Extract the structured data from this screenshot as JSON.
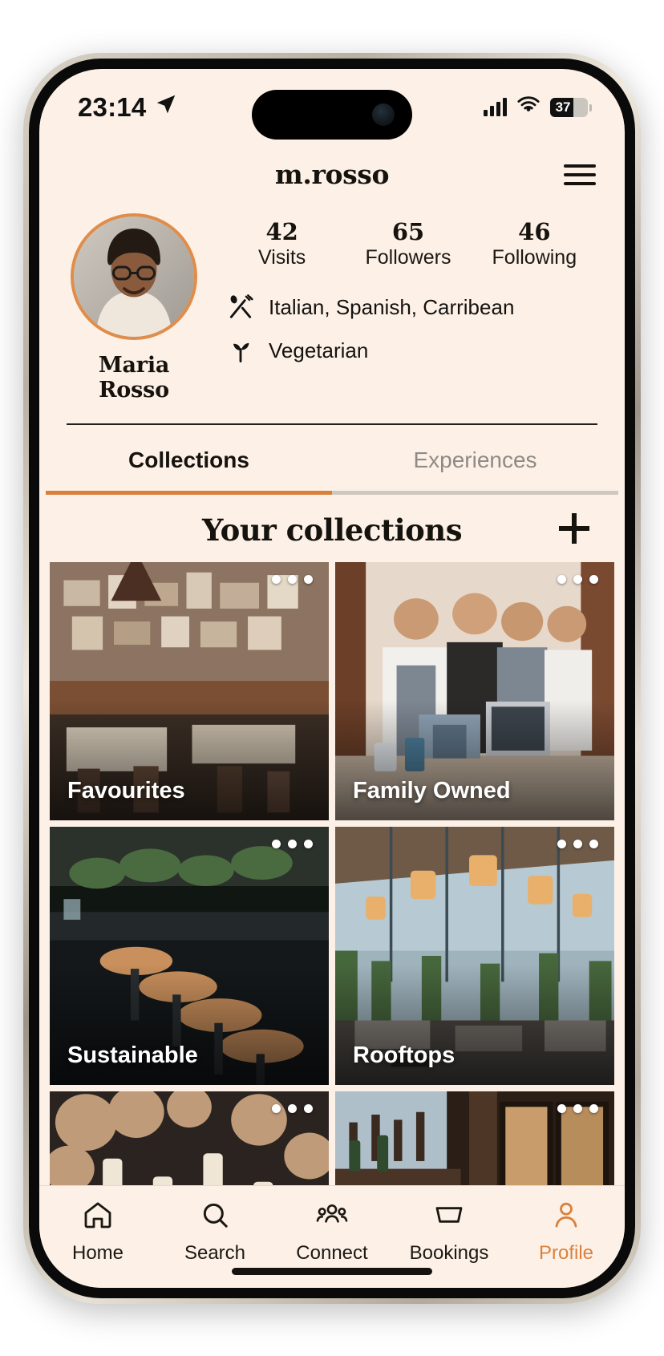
{
  "status_bar": {
    "time": "23:14",
    "location_icon": "location-arrow-icon",
    "signal_icon": "cellular-bars-icon",
    "wifi_icon": "wifi-icon",
    "battery_percent": "37"
  },
  "header": {
    "brand": "m.rosso",
    "menu_icon": "hamburger-menu-icon"
  },
  "profile": {
    "name": "Maria Rosso",
    "avatar_icon": "user-avatar-photo",
    "stats": [
      {
        "value": "42",
        "label": "Visits"
      },
      {
        "value": "65",
        "label": "Followers"
      },
      {
        "value": "46",
        "label": "Following"
      }
    ],
    "tags": [
      {
        "icon": "fork-and-spoon-icon",
        "text": "Italian, Spanish, Carribean"
      },
      {
        "icon": "sprout-leaf-icon",
        "text": "Vegetarian"
      }
    ]
  },
  "tabs": [
    {
      "label": "Collections",
      "active": true
    },
    {
      "label": "Experiences",
      "active": false
    }
  ],
  "collections_section": {
    "title": "Your collections",
    "add_icon": "plus-icon",
    "menu_icon": "three-dots-icon",
    "cards": [
      {
        "title": "Favourites",
        "photo": "restaurant-interior-gallery-wall"
      },
      {
        "title": "Family Owned",
        "photo": "staff-in-aprons-at-counter"
      },
      {
        "title": "Sustainable",
        "photo": "bar-counter-with-plants"
      },
      {
        "title": "Rooftops",
        "photo": "rooftop-terrace-with-lanterns"
      },
      {
        "title": "",
        "photo": "lanterns-and-blossom-tree"
      },
      {
        "title": "",
        "photo": "dark-wood-bar-interior"
      }
    ]
  },
  "bottom_nav": [
    {
      "label": "Home",
      "icon": "home-icon",
      "active": false
    },
    {
      "label": "Search",
      "icon": "search-icon",
      "active": false
    },
    {
      "label": "Connect",
      "icon": "people-group-icon",
      "active": false
    },
    {
      "label": "Bookings",
      "icon": "ticket-icon",
      "active": false
    },
    {
      "label": "Profile",
      "icon": "person-icon",
      "active": true
    }
  ],
  "colors": {
    "background": "#fdf1e7",
    "accent": "#d9813c",
    "text": "#16130f",
    "muted": "#8f8a85"
  }
}
